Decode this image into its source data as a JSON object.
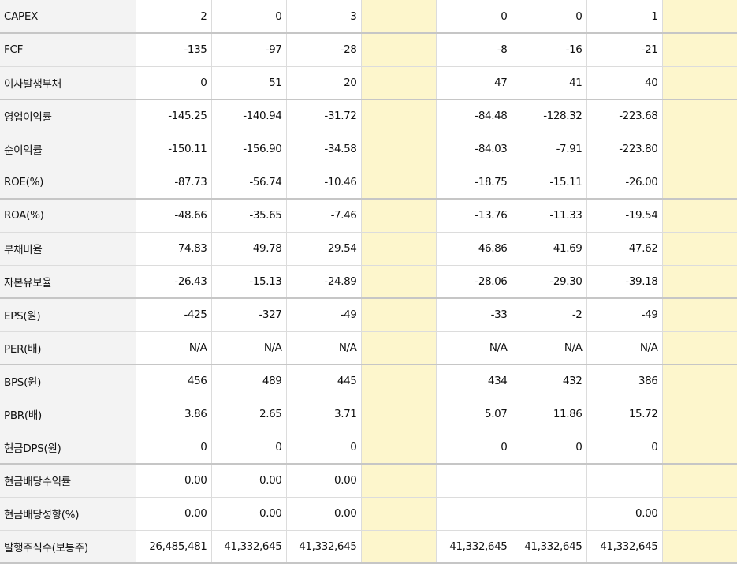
{
  "colors": {
    "label_bg": "#f3f3f3",
    "highlight_column_bg": "#fdf6cc",
    "negative_text": "#d01a1a",
    "grid_line": "#dcdcdc"
  },
  "table": {
    "rows": [
      {
        "label": "CAPEX",
        "values": [
          "2",
          "0",
          "3",
          "0",
          "0",
          "1"
        ],
        "group_end": true
      },
      {
        "label": "FCF",
        "values": [
          "-135",
          "-97",
          "-28",
          "-8",
          "-16",
          "-21"
        ],
        "group_end": false
      },
      {
        "label": "이자발생부채",
        "values": [
          "0",
          "51",
          "20",
          "47",
          "41",
          "40"
        ],
        "group_end": true
      },
      {
        "label": "영업이익률",
        "values": [
          "-145.25",
          "-140.94",
          "-31.72",
          "-84.48",
          "-128.32",
          "-223.68"
        ],
        "group_end": false
      },
      {
        "label": "순이익률",
        "values": [
          "-150.11",
          "-156.90",
          "-34.58",
          "-84.03",
          "-7.91",
          "-223.80"
        ],
        "group_end": false
      },
      {
        "label": "ROE(%)",
        "values": [
          "-87.73",
          "-56.74",
          "-10.46",
          "-18.75",
          "-15.11",
          "-26.00"
        ],
        "group_end": true
      },
      {
        "label": "ROA(%)",
        "values": [
          "-48.66",
          "-35.65",
          "-7.46",
          "-13.76",
          "-11.33",
          "-19.54"
        ],
        "group_end": false
      },
      {
        "label": "부채비율",
        "values": [
          "74.83",
          "49.78",
          "29.54",
          "46.86",
          "41.69",
          "47.62"
        ],
        "group_end": false
      },
      {
        "label": "자본유보율",
        "values": [
          "-26.43",
          "-15.13",
          "-24.89",
          "-28.06",
          "-29.30",
          "-39.18"
        ],
        "group_end": true
      },
      {
        "label": "EPS(원)",
        "values": [
          "-425",
          "-327",
          "-49",
          "-33",
          "-2",
          "-49"
        ],
        "group_end": false
      },
      {
        "label": "PER(배)",
        "values": [
          "N/A",
          "N/A",
          "N/A",
          "N/A",
          "N/A",
          "N/A"
        ],
        "group_end": true
      },
      {
        "label": "BPS(원)",
        "values": [
          "456",
          "489",
          "445",
          "434",
          "432",
          "386"
        ],
        "group_end": false
      },
      {
        "label": "PBR(배)",
        "values": [
          "3.86",
          "2.65",
          "3.71",
          "5.07",
          "11.86",
          "15.72"
        ],
        "group_end": false
      },
      {
        "label": "현금DPS(원)",
        "values": [
          "0",
          "0",
          "0",
          "0",
          "0",
          "0"
        ],
        "group_end": true
      },
      {
        "label": "현금배당수익률",
        "values": [
          "0.00",
          "0.00",
          "0.00",
          "",
          "",
          ""
        ],
        "group_end": false
      },
      {
        "label": "현금배당성향(%)",
        "values": [
          "0.00",
          "0.00",
          "0.00",
          "",
          "",
          "0.00"
        ],
        "group_end": false
      },
      {
        "label": "발행주식수(보통주)",
        "values": [
          "26,485,481",
          "41,332,645",
          "41,332,645",
          "41,332,645",
          "41,332,645",
          "41,332,645"
        ],
        "group_end": true
      }
    ]
  }
}
